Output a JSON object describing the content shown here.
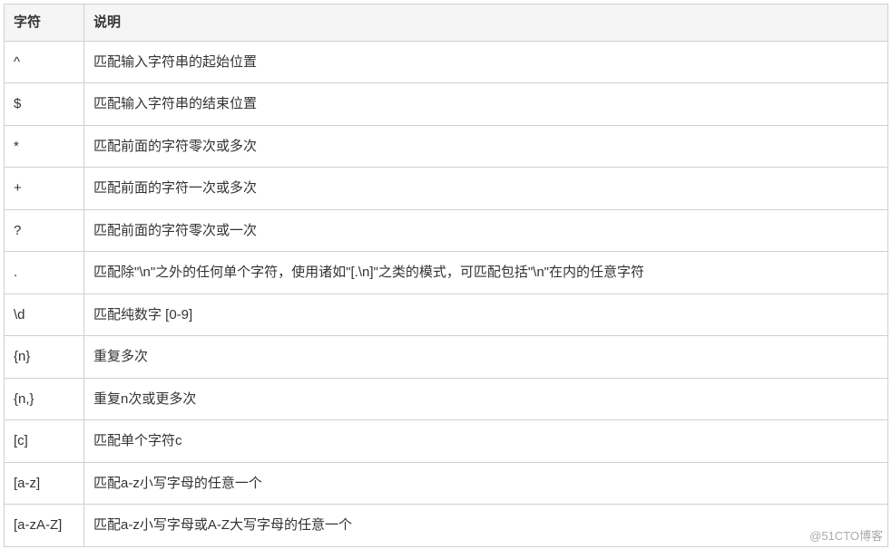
{
  "table": {
    "headers": {
      "col1": "字符",
      "col2": "说明"
    },
    "rows": [
      {
        "char": "^",
        "desc": "匹配输入字符串的起始位置"
      },
      {
        "char": "$",
        "desc": "匹配输入字符串的结束位置"
      },
      {
        "char": "*",
        "desc": "匹配前面的字符零次或多次"
      },
      {
        "char": "+",
        "desc": "匹配前面的字符一次或多次"
      },
      {
        "char": "?",
        "desc": "匹配前面的字符零次或一次"
      },
      {
        "char": ".",
        "desc": "匹配除\"\\n\"之外的任何单个字符，使用诸如\"[.\\n]\"之类的模式，可匹配包括\"\\n\"在内的任意字符"
      },
      {
        "char": "\\d",
        "desc": "匹配纯数字 [0-9]"
      },
      {
        "char": "{n}",
        "desc": "重复多次"
      },
      {
        "char": "{n,}",
        "desc": "重复n次或更多次"
      },
      {
        "char": "[c]",
        "desc": "匹配单个字符c"
      },
      {
        "char": "[a-z]",
        "desc": "匹配a-z小写字母的任意一个"
      },
      {
        "char": "[a-zA-Z]",
        "desc": "匹配a-z小写字母或A-Z大写字母的任意一个"
      }
    ]
  },
  "watermark": "@51CTO博客"
}
